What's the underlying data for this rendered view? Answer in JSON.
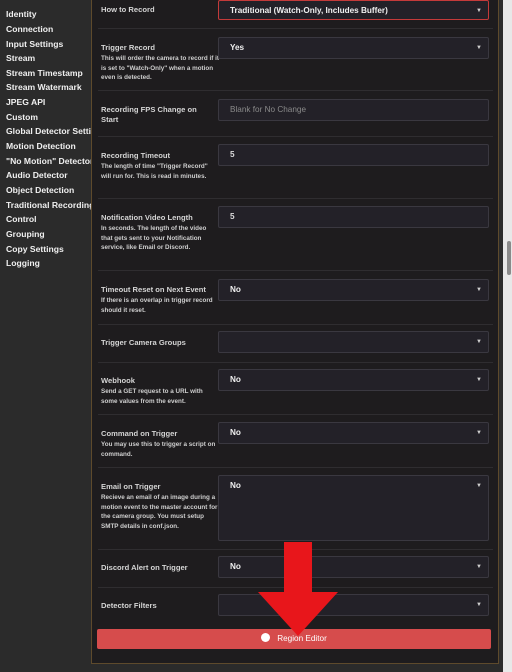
{
  "sidebar": {
    "items": [
      "Identity",
      "Connection",
      "Input Settings",
      "Stream",
      "Stream Timestamp",
      "Stream Watermark",
      "JPEG API",
      "Custom",
      "Global Detector Settings",
      "Motion Detection",
      "\"No Motion\" Detector",
      "Audio Detector",
      "Object Detection",
      "Traditional Recording",
      "Control",
      "Grouping",
      "Copy Settings",
      "Logging"
    ]
  },
  "form": {
    "how_to_record": {
      "label": "How to Record",
      "value": "Traditional (Watch-Only, Includes Buffer)"
    },
    "trigger_record": {
      "label": "Trigger Record",
      "desc": "This will order the camera to record if it is set to \"Watch-Only\" when a motion even is detected.",
      "value": "Yes"
    },
    "recording_fps_change": {
      "label": "Recording FPS Change on Start",
      "placeholder": "Blank for No Change"
    },
    "recording_timeout": {
      "label": "Recording Timeout",
      "desc": "The length of time \"Trigger Record\" will run for. This is read in minutes.",
      "value": "5"
    },
    "notification_video_length": {
      "label": "Notification Video Length",
      "desc": "In seconds. The length of the video that gets sent to your Notification service, like Email or Discord.",
      "value": "5"
    },
    "timeout_reset": {
      "label": "Timeout Reset on Next Event",
      "desc": "If there is an overlap in trigger record should it reset.",
      "value": "No"
    },
    "trigger_camera_groups": {
      "label": "Trigger Camera Groups",
      "value": ""
    },
    "webhook": {
      "label": "Webhook",
      "desc": "Send a GET request to a URL with some values from the event.",
      "value": "No"
    },
    "command_on_trigger": {
      "label": "Command on Trigger",
      "desc": "You may use this to trigger a script on command.",
      "value": "No"
    },
    "email_on_trigger": {
      "label": "Email on Trigger",
      "desc": "Recieve an email of an image during a motion event to the master account for the camera group. You must setup SMTP details in conf.json.",
      "value": "No"
    },
    "discord_alert": {
      "label": "Discord Alert on Trigger",
      "value": "No"
    },
    "detector_filters": {
      "label": "Detector Filters",
      "value": ""
    }
  },
  "region_editor": {
    "label": "Region Editor"
  },
  "colors": {
    "accent": "#d64c4c",
    "panel_bg": "#1e1c1e",
    "page_bg": "#2b2b2b",
    "arrow": "#e8161b"
  },
  "icons": {
    "select": "caret-down-icon",
    "region_editor": "circle-icon",
    "annotation": "arrow-down-icon"
  }
}
